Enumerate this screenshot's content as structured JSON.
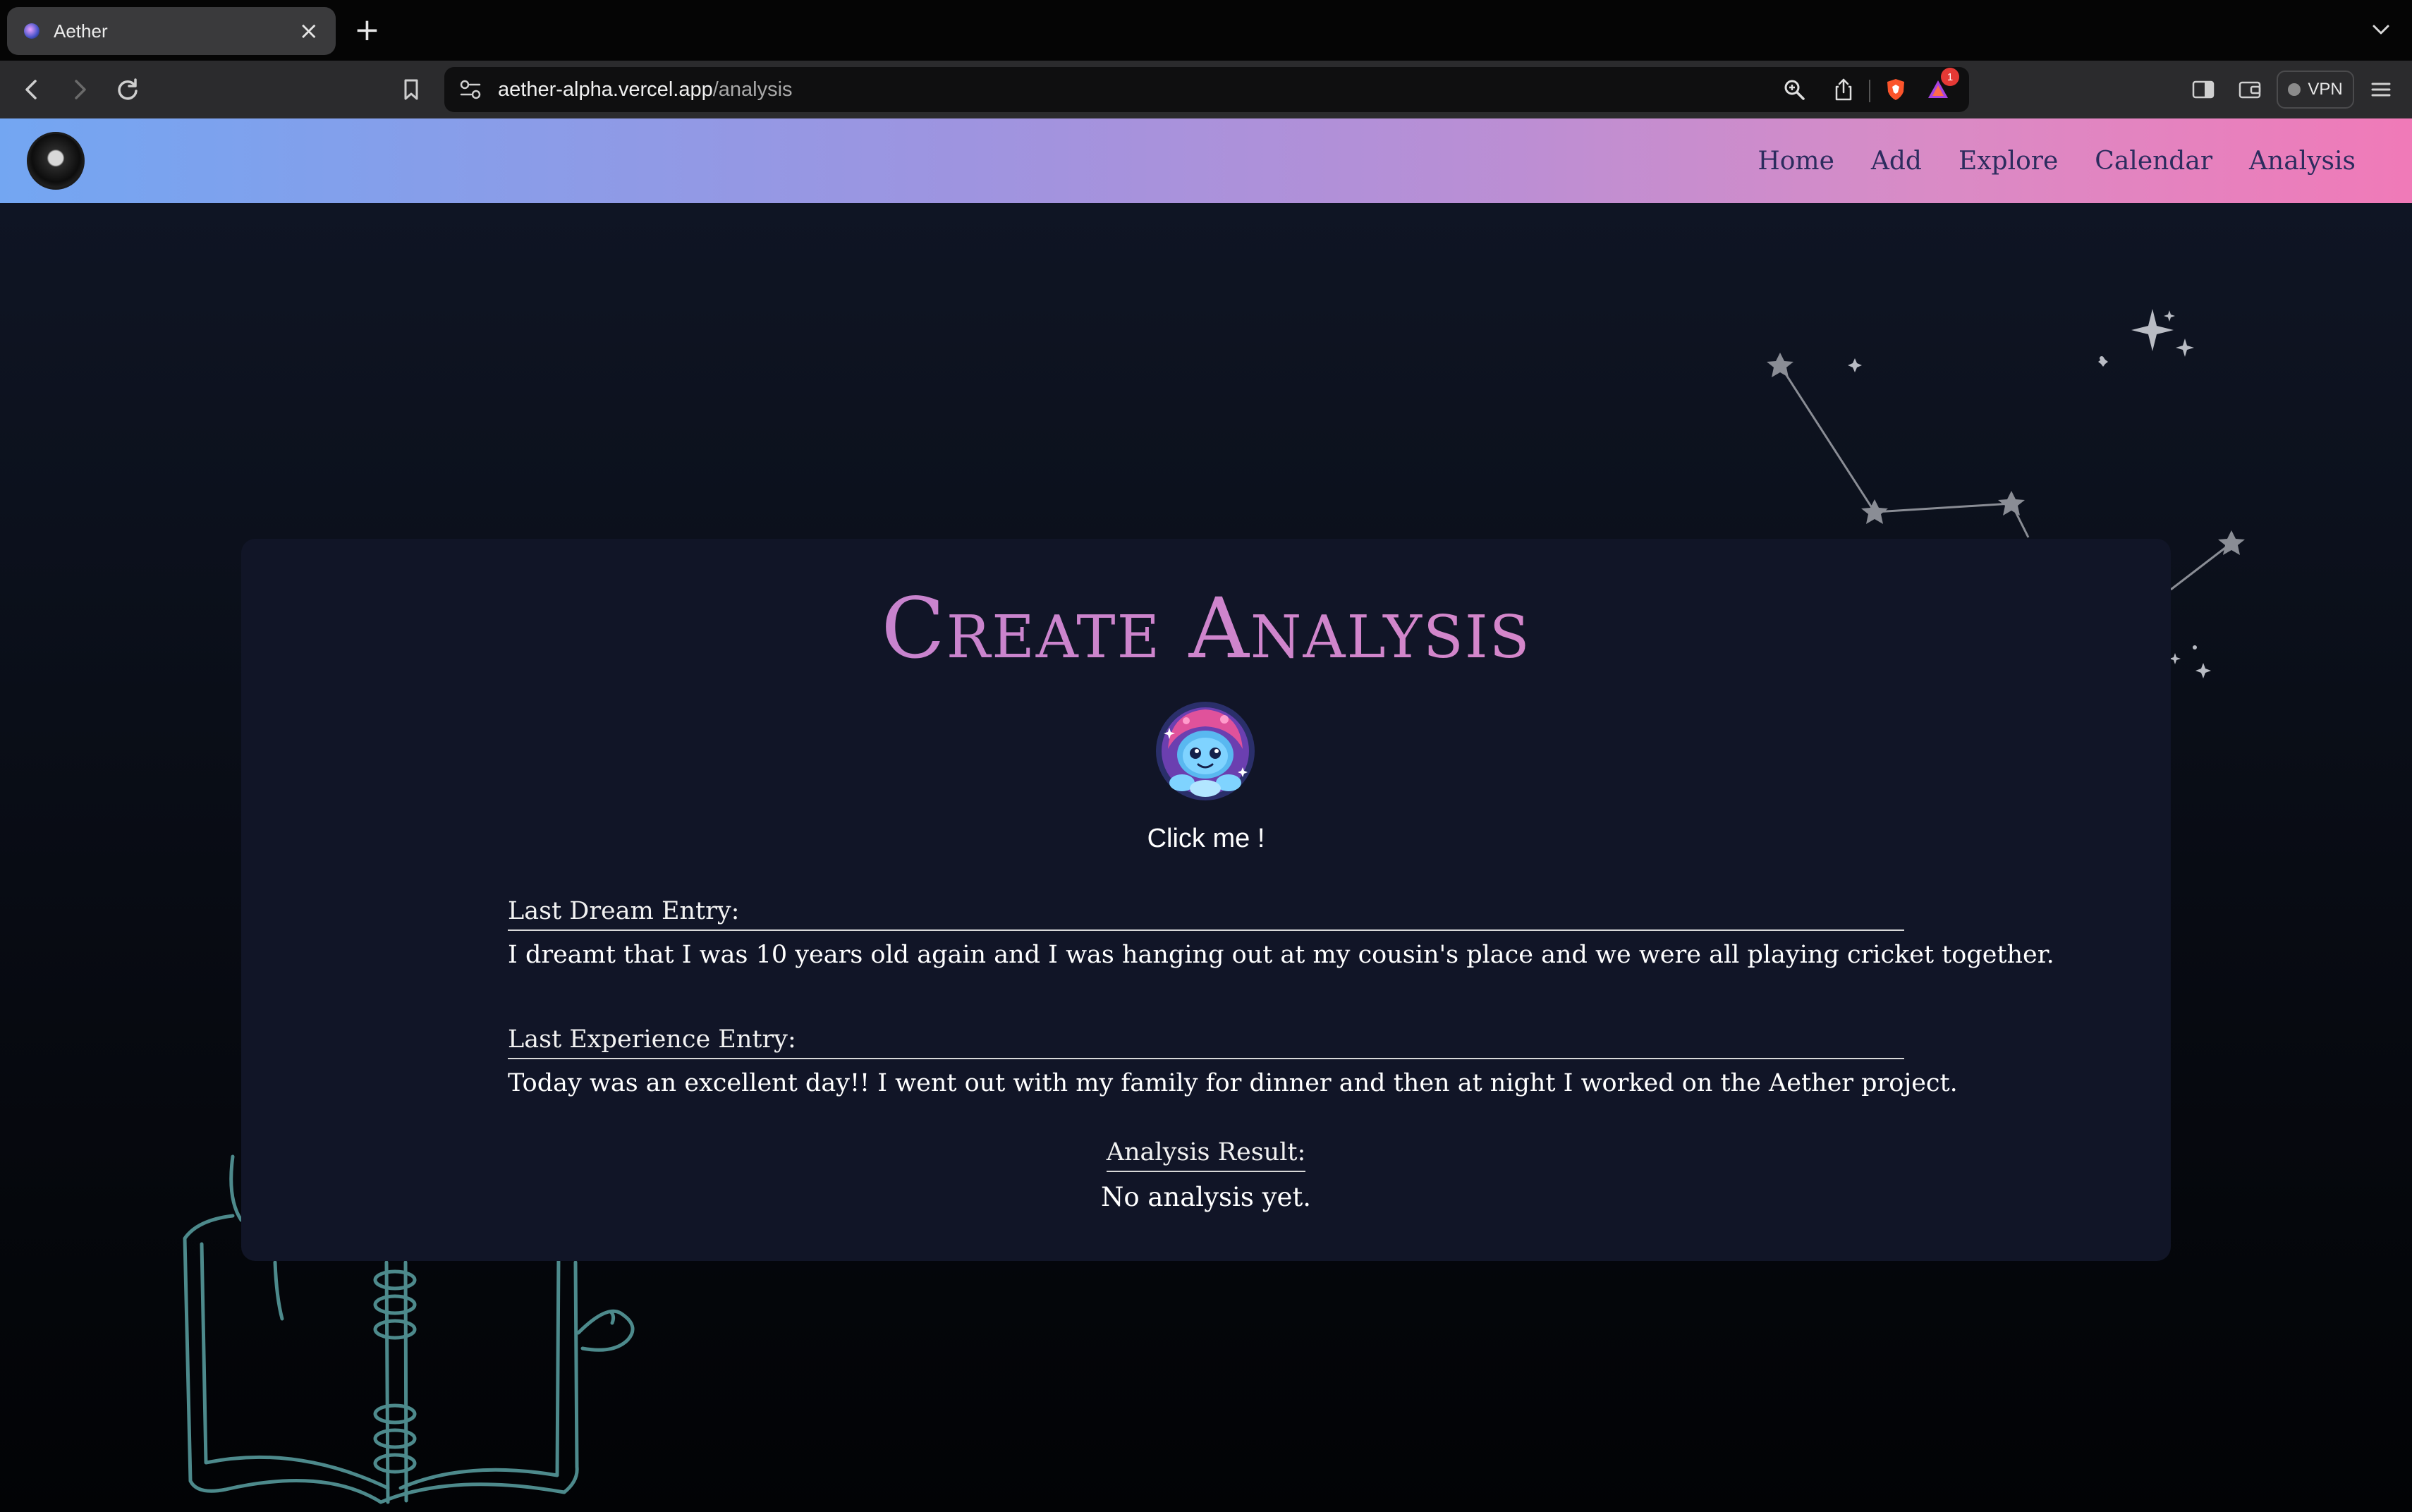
{
  "browser": {
    "tab_title": "Aether",
    "close_glyph": "×",
    "new_tab_glyph": "+",
    "url_host": "aether-alpha.vercel.app",
    "url_path": "/analysis",
    "notification_count": "1",
    "vpn_label": "VPN"
  },
  "site": {
    "nav": {
      "home": "Home",
      "add": "Add",
      "explore": "Explore",
      "calendar": "Calendar",
      "analysis": "Analysis"
    },
    "accent_gradient": [
      "#73a6f2",
      "#f07ab8"
    ]
  },
  "analysis": {
    "title": "Create Analysis",
    "click_me": "Click me !",
    "last_dream_label": "Last Dream Entry:",
    "last_dream_text": "I dreamt that I was 10 years old again and I was hanging out at my cousin's place and we were all playing cricket together.",
    "last_experience_label": "Last Experience Entry:",
    "last_experience_text": "Today was an excellent day!! I went out with my family for dinner and then at night I worked on the Aether project.",
    "result_label": "Analysis Result:",
    "result_value": "No analysis yet."
  }
}
